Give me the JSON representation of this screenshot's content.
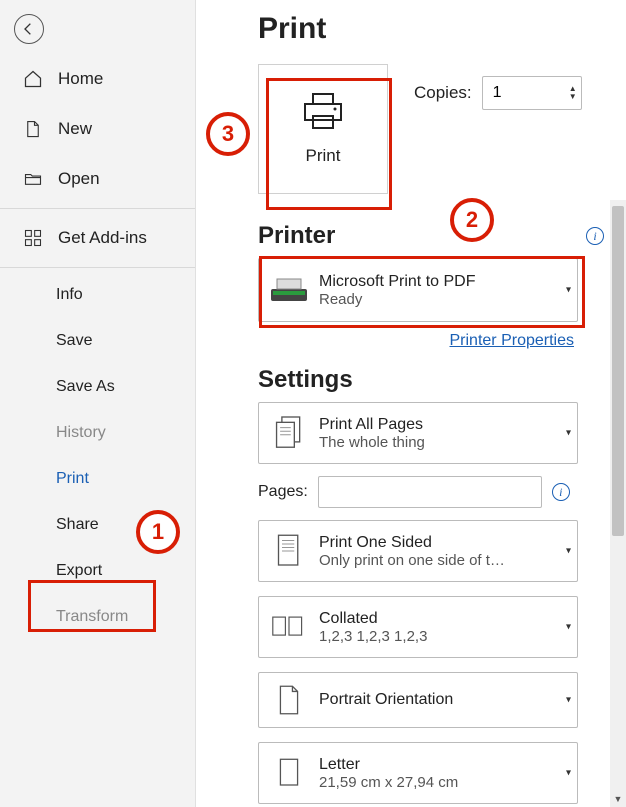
{
  "title": "Print",
  "sidebar": {
    "primary": [
      {
        "label": "Home"
      },
      {
        "label": "New"
      },
      {
        "label": "Open"
      }
    ],
    "secondary": [
      {
        "label": "Get Add-ins"
      }
    ],
    "sub": [
      {
        "label": "Info",
        "dim": false
      },
      {
        "label": "Save",
        "dim": false
      },
      {
        "label": "Save As",
        "dim": false
      },
      {
        "label": "History",
        "dim": true
      },
      {
        "label": "Print",
        "selected": true
      },
      {
        "label": "Share",
        "dim": false
      },
      {
        "label": "Export",
        "dim": false
      },
      {
        "label": "Transform",
        "dim": true
      }
    ]
  },
  "copies": {
    "label": "Copies:",
    "value": "1"
  },
  "print_button": {
    "label": "Print"
  },
  "printer": {
    "heading": "Printer",
    "name": "Microsoft Print to PDF",
    "status": "Ready",
    "properties_link": "Printer Properties"
  },
  "settings": {
    "heading": "Settings",
    "pages_label": "Pages:",
    "items": [
      {
        "line1": "Print All Pages",
        "line2": "The whole thing"
      },
      {
        "line1": "Print One Sided",
        "line2": "Only print on one side of t…"
      },
      {
        "line1": "Collated",
        "line2": "1,2,3    1,2,3    1,2,3"
      },
      {
        "line1": "Portrait Orientation",
        "line2": ""
      },
      {
        "line1": "Letter",
        "line2": "21,59 cm x 27,94 cm"
      }
    ]
  },
  "callouts": {
    "c1": "1",
    "c2": "2",
    "c3": "3"
  }
}
